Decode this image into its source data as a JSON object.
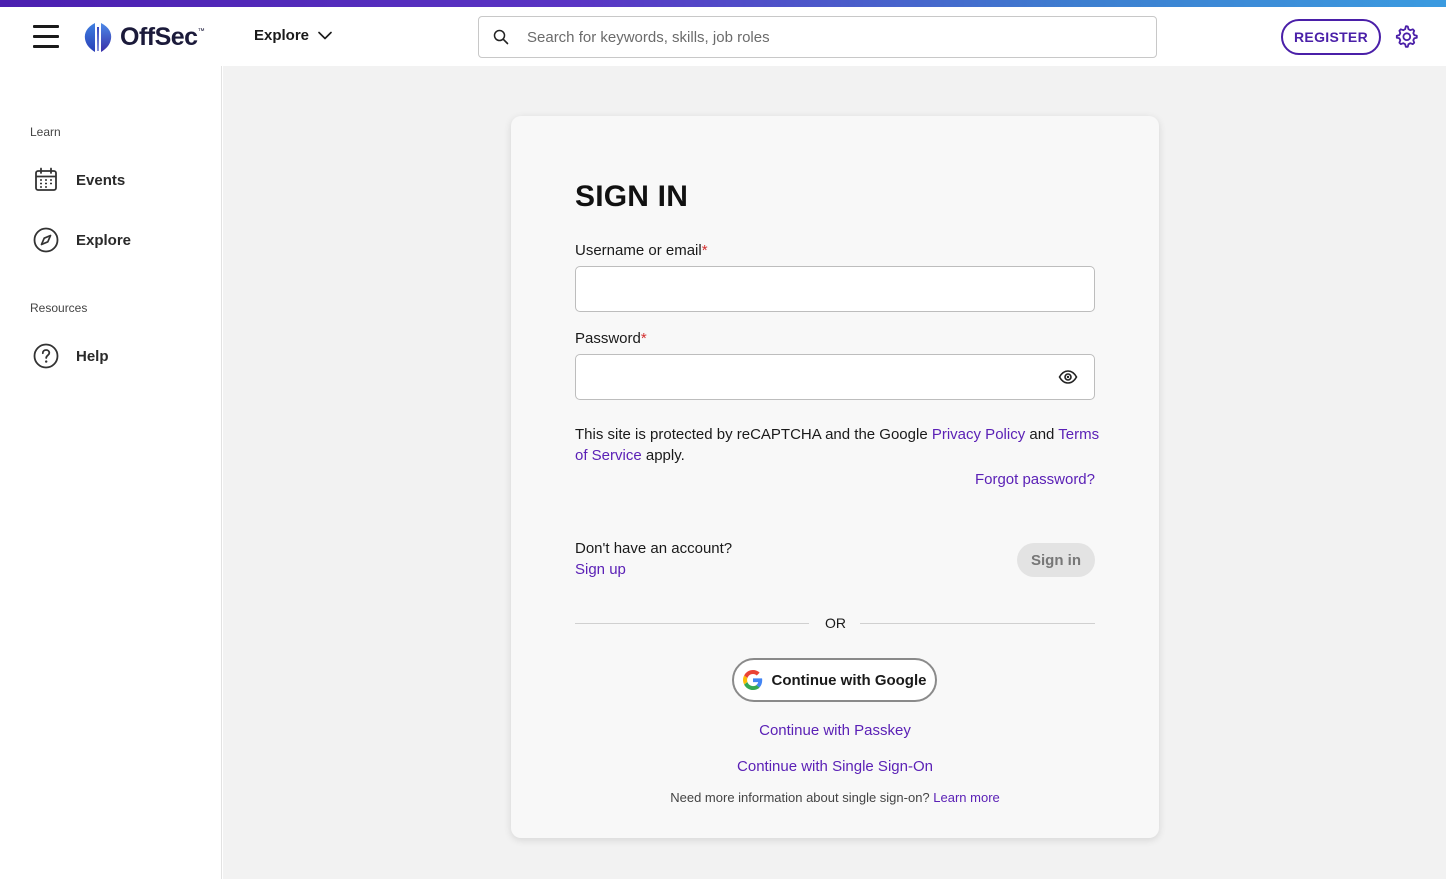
{
  "header": {
    "logo_text": "OffSec",
    "logo_tm": "™",
    "explore_label": "Explore",
    "search_placeholder": "Search for keywords, skills, job roles",
    "register_label": "REGISTER"
  },
  "sidebar": {
    "sections": [
      {
        "title": "Learn",
        "items": [
          {
            "label": "Events",
            "icon": "calendar-icon"
          },
          {
            "label": "Explore",
            "icon": "compass-icon"
          }
        ]
      },
      {
        "title": "Resources",
        "items": [
          {
            "label": "Help",
            "icon": "help-icon"
          }
        ]
      }
    ]
  },
  "signin": {
    "title": "SIGN IN",
    "username_label": "Username or email",
    "password_label": "Password",
    "required_mark": "*",
    "recaptcha_prefix": "This site is protected by reCAPTCHA and the Google ",
    "privacy_policy": "Privacy Policy",
    "recaptcha_and": " and ",
    "terms_of_service": "Terms of Service",
    "recaptcha_suffix": " apply.",
    "forgot_password": "Forgot password?",
    "no_account": "Don't have an account?",
    "sign_up": "Sign up",
    "sign_in_button": "Sign in",
    "or_text": "OR",
    "google_button": "Continue with Google",
    "passkey_link": "Continue with Passkey",
    "sso_link": "Continue with Single Sign-On",
    "sso_info": "Need more information about single sign-on? ",
    "learn_more": "Learn more"
  },
  "colors": {
    "accent": "#5b21b6",
    "register_border": "#4a1fa8",
    "required": "#d32f2f",
    "background": "#f2f2f2"
  }
}
